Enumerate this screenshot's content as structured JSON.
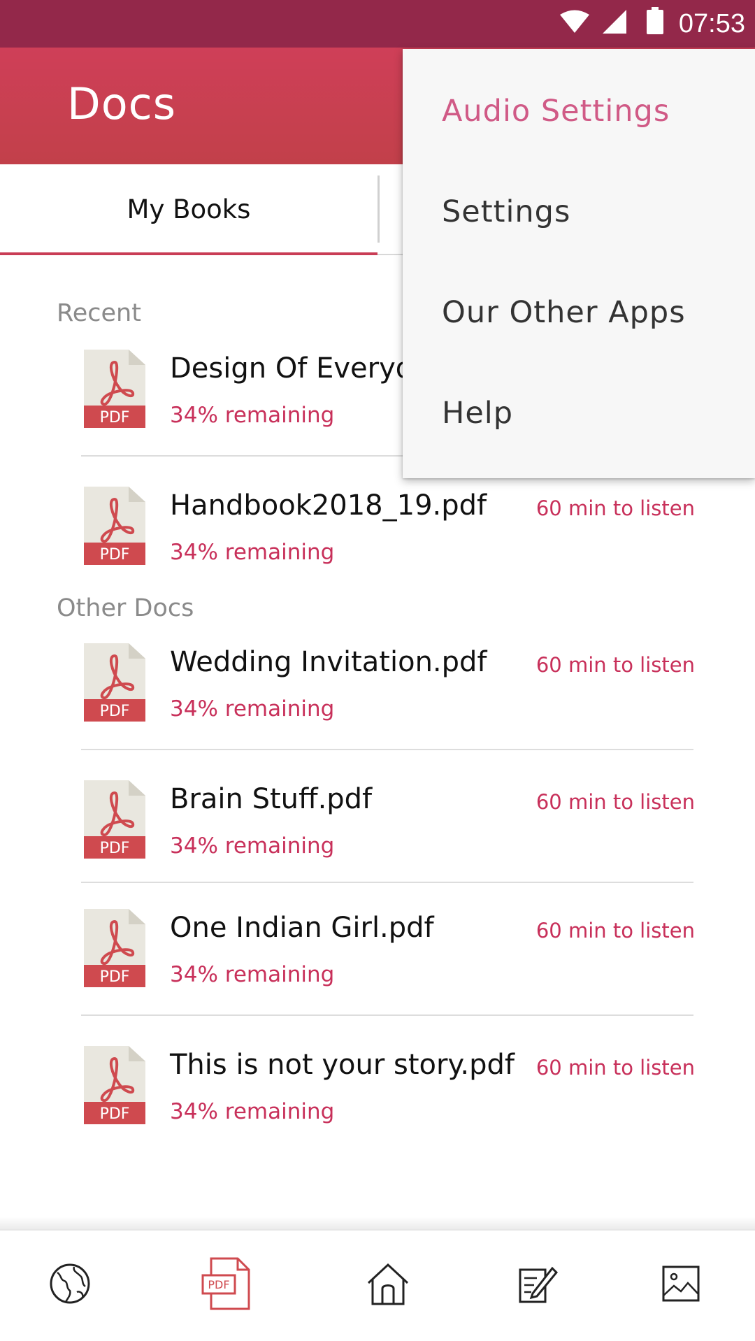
{
  "status_bar": {
    "time": "07:53",
    "icons": [
      "wifi-icon",
      "cell-signal-icon",
      "battery-icon"
    ]
  },
  "app_bar": {
    "title": "Docs"
  },
  "tabs": [
    {
      "label": "My Books",
      "active": true
    },
    {
      "label": "",
      "active": false
    }
  ],
  "sections": {
    "recent_label": "Recent",
    "other_label": "Other Docs"
  },
  "recent_docs": [
    {
      "title": "Design Of Everyday",
      "progress": "34% remaining",
      "listen": ""
    },
    {
      "title": "Handbook2018_19.pdf",
      "progress": "34% remaining",
      "listen": "60 min to listen"
    }
  ],
  "other_docs": [
    {
      "title": "Wedding Invitation.pdf",
      "progress": "34% remaining",
      "listen": "60 min to listen"
    },
    {
      "title": "Brain Stuff.pdf",
      "progress": "34% remaining",
      "listen": "60 min to listen"
    },
    {
      "title": "One Indian Girl.pdf",
      "progress": "34% remaining",
      "listen": "60 min to listen"
    },
    {
      "title": "This is not your story.pdf",
      "progress": "34% remaining",
      "listen": "60 min to listen"
    }
  ],
  "pdf_icon_label": "PDF",
  "overflow_menu": {
    "items": [
      {
        "label": "Audio Settings",
        "highlighted": true
      },
      {
        "label": "Settings",
        "highlighted": false
      },
      {
        "label": "Our Other Apps",
        "highlighted": false
      },
      {
        "label": "Help",
        "highlighted": false
      }
    ]
  },
  "bottom_nav": {
    "items": [
      {
        "icon": "globe-icon",
        "active": false
      },
      {
        "icon": "pdf-file-icon",
        "label": "PDF",
        "active": true
      },
      {
        "icon": "home-icon",
        "active": false
      },
      {
        "icon": "edit-note-icon",
        "active": false
      },
      {
        "icon": "image-icon",
        "active": false
      }
    ]
  },
  "colors": {
    "status_bar": "#93284a",
    "app_bar": "#cf3f58",
    "accent": "#c8305a",
    "menu_highlight": "#d05a86",
    "pdf_icon_red": "#cf4a4f",
    "pdf_icon_paper": "#e9e7df"
  }
}
